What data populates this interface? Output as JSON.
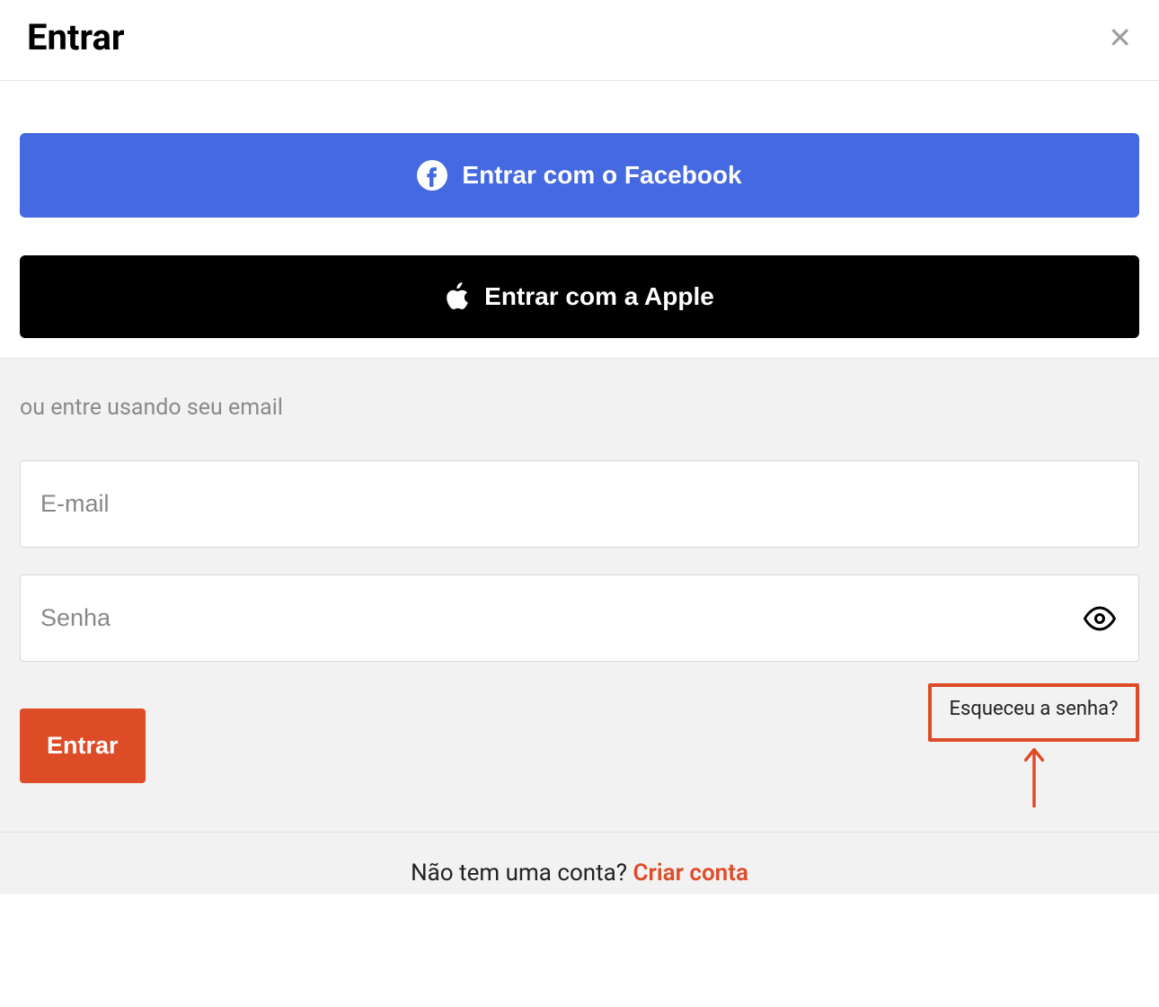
{
  "header": {
    "title": "Entrar"
  },
  "social": {
    "facebook_label": "Entrar com o Facebook",
    "apple_label": "Entrar com a Apple"
  },
  "emailSection": {
    "intro": "ou entre usando seu email",
    "email_placeholder": "E-mail",
    "password_placeholder": "Senha",
    "submit_label": "Entrar",
    "forgot_label": "Esqueceu a senha?"
  },
  "footer": {
    "prompt": "Não tem uma conta? ",
    "create_label": "Criar conta"
  },
  "colors": {
    "accent": "#de4b27",
    "facebook": "#4469e0",
    "apple": "#000000"
  }
}
